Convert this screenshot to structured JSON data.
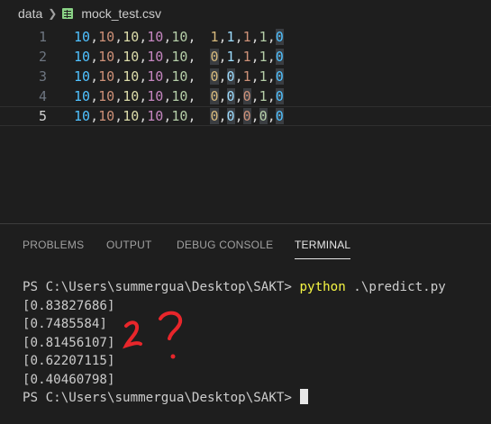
{
  "breadcrumb": {
    "folder": "data",
    "file": "mock_test.csv"
  },
  "editor": {
    "lines": [
      {
        "num": "1",
        "c": [
          "10",
          "10",
          "10",
          "10",
          "10"
        ],
        "t": [
          "1",
          "1",
          "1",
          "1",
          "0"
        ]
      },
      {
        "num": "2",
        "c": [
          "10",
          "10",
          "10",
          "10",
          "10"
        ],
        "t": [
          "0",
          "1",
          "1",
          "1",
          "0"
        ]
      },
      {
        "num": "3",
        "c": [
          "10",
          "10",
          "10",
          "10",
          "10"
        ],
        "t": [
          "0",
          "0",
          "1",
          "1",
          "0"
        ]
      },
      {
        "num": "4",
        "c": [
          "10",
          "10",
          "10",
          "10",
          "10"
        ],
        "t": [
          "0",
          "0",
          "0",
          "1",
          "0"
        ]
      },
      {
        "num": "5",
        "c": [
          "10",
          "10",
          "10",
          "10",
          "10"
        ],
        "t": [
          "0",
          "0",
          "0",
          "0",
          "0"
        ]
      }
    ],
    "column_colors": [
      "#4fc1ff",
      "#ce9178",
      "#dcdcaa",
      "#c586c0",
      "#b5cea8",
      "#d7ba7d",
      "#9cdcfe",
      "#ce9178",
      "#b5cea8",
      "#4fc1ff"
    ]
  },
  "panel": {
    "tabs": [
      "PROBLEMS",
      "OUTPUT",
      "DEBUG CONSOLE",
      "TERMINAL"
    ],
    "active_tab": "TERMINAL"
  },
  "terminal": {
    "prompt": "PS C:\\Users\\summergua\\Desktop\\SAKT> ",
    "command": "python",
    "arg": " .\\predict.py",
    "outputs": [
      "[0.83827686]",
      "[0.7485584]",
      "[0.81456107]",
      "[0.62207115]",
      "[0.40460798]"
    ],
    "final_prompt": "PS C:\\Users\\summergua\\Desktop\\SAKT> "
  },
  "annotation_color": "#e8262b"
}
